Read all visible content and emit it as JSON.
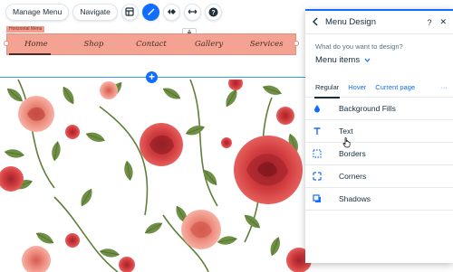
{
  "toolbar": {
    "manage_menu_label": "Manage Menu",
    "navigate_label": "Navigate",
    "icons": [
      "layout-icon",
      "design-brush-icon",
      "animation-icon",
      "stretch-icon",
      "help-icon"
    ],
    "accent": "#116dff"
  },
  "menu": {
    "tag_label": "Horizontal Menu",
    "items": [
      {
        "label": "Home",
        "current": true
      },
      {
        "label": "Shop",
        "current": false
      },
      {
        "label": "Contact",
        "current": false
      },
      {
        "label": "Gallery",
        "current": false
      },
      {
        "label": "Services",
        "current": false
      }
    ],
    "background_color": "#f4a292"
  },
  "canvas": {
    "add_section_symbol": "+"
  },
  "panel": {
    "title": "Menu Design",
    "help_symbol": "?",
    "close_symbol": "✕",
    "question": "What do you want to design?",
    "dropdown_value": "Menu items",
    "tabs": [
      {
        "label": "Regular",
        "selected": true
      },
      {
        "label": "Hover",
        "selected": false
      },
      {
        "label": "Current page",
        "selected": false
      }
    ],
    "more_tabs": "···",
    "rows": [
      {
        "label": "Background Fills",
        "icon": "paint-drop-icon"
      },
      {
        "label": "Text",
        "icon": "text-t-icon"
      },
      {
        "label": "Borders",
        "icon": "dotted-border-icon"
      },
      {
        "label": "Corners",
        "icon": "corners-icon"
      },
      {
        "label": "Shadows",
        "icon": "shadow-box-icon"
      }
    ]
  }
}
